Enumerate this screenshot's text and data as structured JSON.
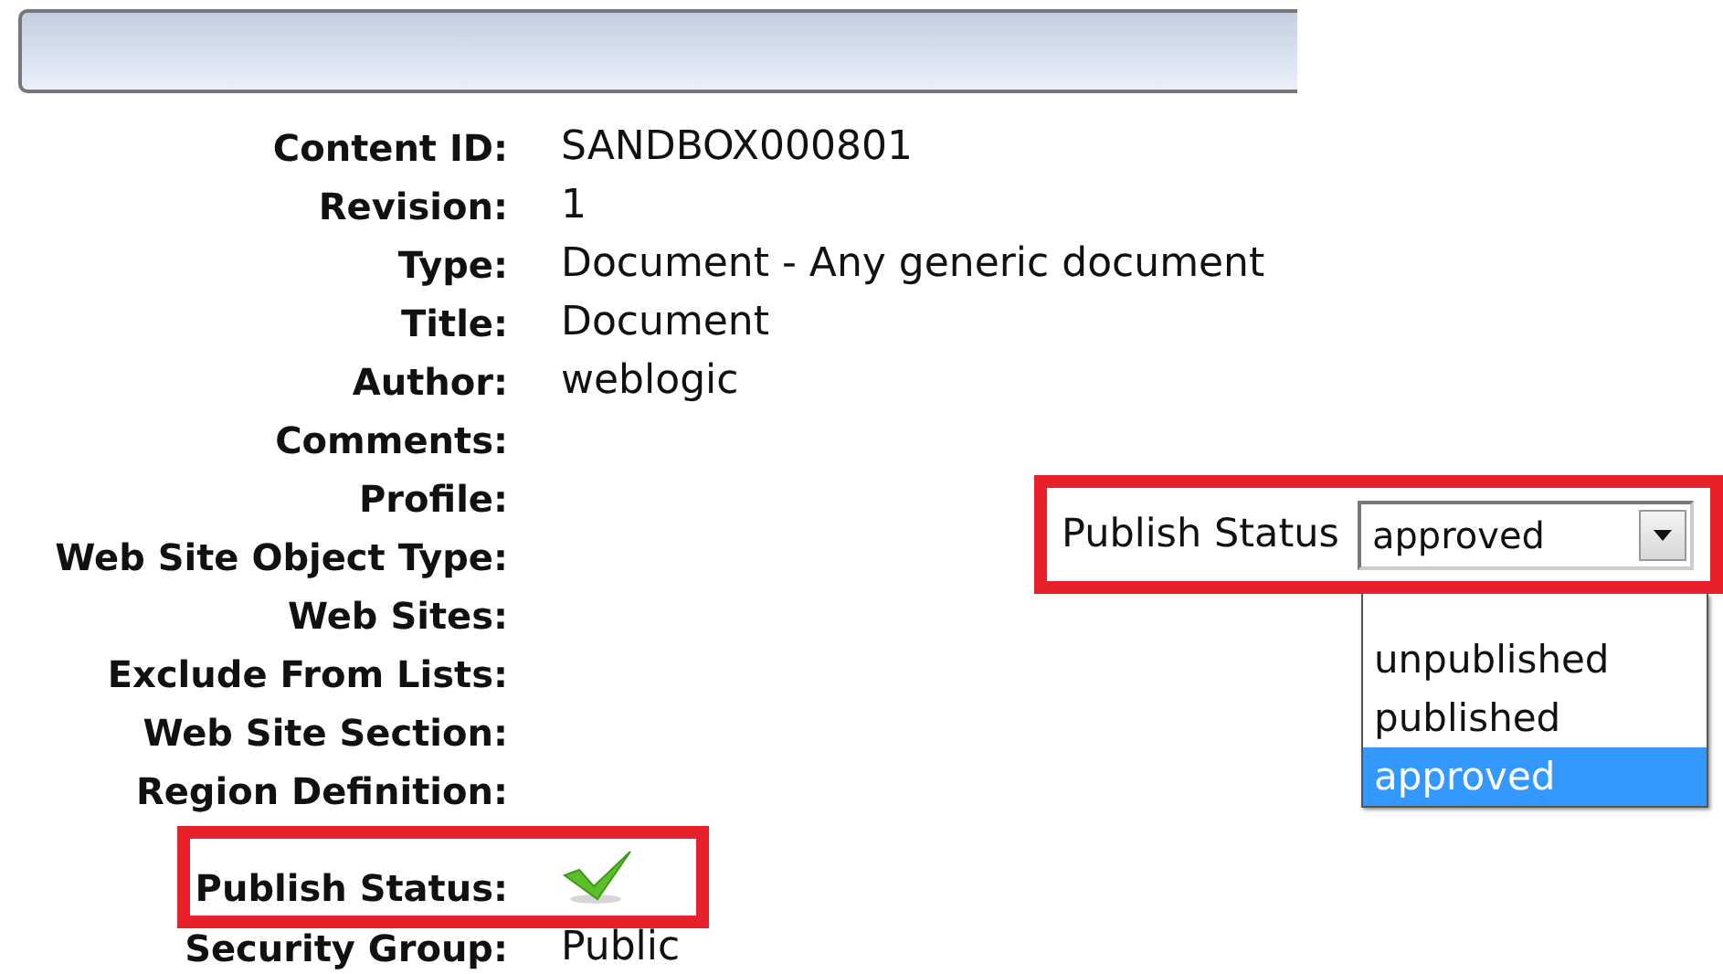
{
  "fields": [
    {
      "label": "Content ID:",
      "kind": "text",
      "value": "SANDBOX000801",
      "highlighted": false
    },
    {
      "label": "Revision:",
      "kind": "text",
      "value": "1",
      "highlighted": false
    },
    {
      "label": "Type:",
      "kind": "text",
      "value": "Document - Any generic document",
      "highlighted": false
    },
    {
      "label": "Title:",
      "kind": "text",
      "value": "Document",
      "highlighted": false
    },
    {
      "label": "Author:",
      "kind": "text",
      "value": "weblogic",
      "highlighted": false
    },
    {
      "label": "Comments:",
      "kind": "text",
      "highlighted": false
    },
    {
      "label": "Profile:",
      "kind": "text",
      "highlighted": false
    },
    {
      "label": "Web Site Object Type:",
      "kind": "text",
      "highlighted": false
    },
    {
      "label": "Web Sites:",
      "kind": "text",
      "highlighted": false
    },
    {
      "label": "Exclude From Lists:",
      "kind": "text",
      "highlighted": false
    },
    {
      "label": "Web Site Section:",
      "kind": "text",
      "highlighted": false
    },
    {
      "label": "Region Definition:",
      "kind": "text",
      "highlighted": false
    },
    {
      "label": "Publish Status:",
      "kind": "check",
      "highlighted": true
    },
    {
      "label": "Security Group:",
      "kind": "text",
      "value": "Public",
      "highlighted": false
    }
  ],
  "publish_status_select": {
    "label": "Publish Status",
    "value": "approved",
    "highlighted": true,
    "expanded": true,
    "options": [
      {
        "label": "unpublished",
        "selected": false
      },
      {
        "label": "published",
        "selected": false
      },
      {
        "label": "approved",
        "selected": true
      }
    ]
  }
}
